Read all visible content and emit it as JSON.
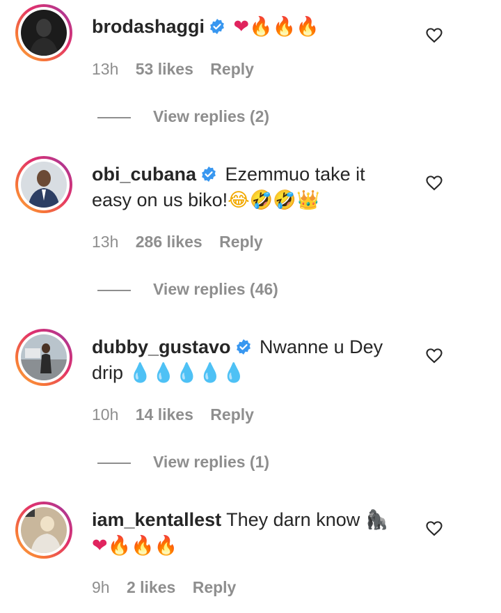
{
  "comments": [
    {
      "username": "brodashaggi",
      "text": "",
      "emojis": [
        {
          "char": "❤",
          "cls": "red"
        },
        {
          "char": "🔥",
          "cls": "fire"
        },
        {
          "char": "🔥",
          "cls": "fire"
        },
        {
          "char": "🔥",
          "cls": "fire"
        }
      ],
      "time": "13h",
      "likes": "53 likes",
      "reply": "Reply",
      "view_replies": "View replies (2)"
    },
    {
      "username": "obi_cubana",
      "text": "Ezemmuo take it easy on us biko!",
      "emojis": [
        {
          "char": "😂",
          "cls": "laugh"
        },
        {
          "char": "🤣",
          "cls": "laugh"
        },
        {
          "char": "🤣",
          "cls": "laugh"
        },
        {
          "char": "👑",
          "cls": "crown"
        }
      ],
      "time": "13h",
      "likes": "286 likes",
      "reply": "Reply",
      "view_replies": "View replies (46)"
    },
    {
      "username": "dubby_gustavo",
      "text": "Nwanne u Dey drip",
      "emojis": [
        {
          "char": "💧",
          "cls": "drop"
        },
        {
          "char": "💧",
          "cls": "drop"
        },
        {
          "char": "💧",
          "cls": "drop"
        },
        {
          "char": "💧",
          "cls": "drop"
        },
        {
          "char": "💧",
          "cls": "drop"
        }
      ],
      "time": "10h",
      "likes": "14 likes",
      "reply": "Reply",
      "view_replies": "View replies (1)"
    },
    {
      "username": "iam_kentallest",
      "text": "They darn know",
      "emojis": [
        {
          "char": "🦍",
          "cls": "gorilla"
        },
        {
          "char": "❤",
          "cls": "red"
        },
        {
          "char": "🔥",
          "cls": "fire"
        },
        {
          "char": "🔥",
          "cls": "fire"
        },
        {
          "char": "🔥",
          "cls": "fire"
        }
      ],
      "time": "9h",
      "likes": "2 likes",
      "reply": "Reply"
    }
  ],
  "colors": {
    "text": "#262626",
    "meta": "#8e8e8e",
    "verified": "#3897f0"
  }
}
